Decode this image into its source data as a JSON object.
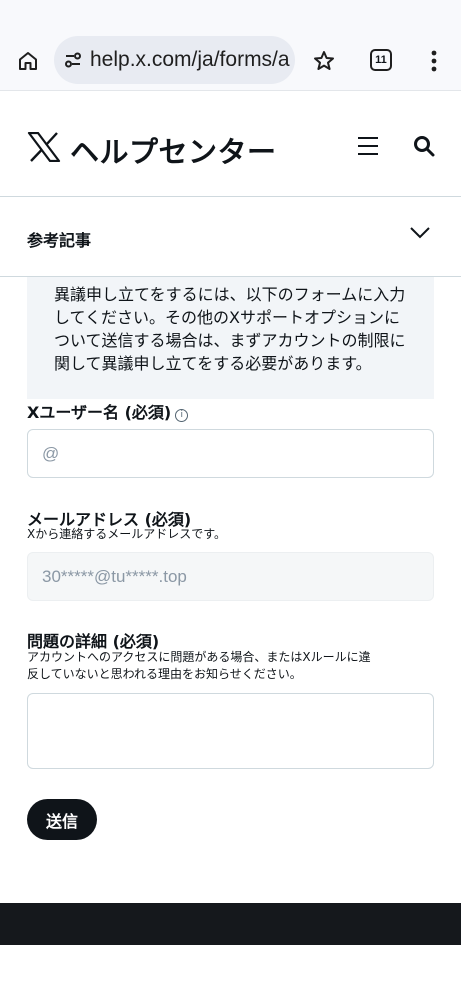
{
  "browser": {
    "url": "help.x.com/ja/forms/a",
    "tab_count": "11"
  },
  "header": {
    "title": "ヘルプセンター"
  },
  "related": {
    "title": "参考記事"
  },
  "notice": {
    "line1": "異議申し立てをするには、以下のフォームに入力",
    "line2": "してください。その他のXサポートオプションに",
    "line3": "ついて送信する場合は、まずアカウントの制限に",
    "line4": "関して異議申し立てをする必要があります。"
  },
  "form": {
    "username": {
      "label": "Xユーザー名 (必須)",
      "info": "i",
      "placeholder": "@"
    },
    "email": {
      "label": "メールアドレス (必須)",
      "hint": "Xから連絡するメールアドレスです。",
      "value": "30*****@tu*****.top"
    },
    "details": {
      "label": "問題の詳細 (必須)",
      "hint_line1": "アカウントへのアクセスに問題がある場合、またはXルールに違",
      "hint_line2": "反していないと思われる理由をお知らせください。",
      "value": ""
    },
    "submit_label": "送信"
  }
}
